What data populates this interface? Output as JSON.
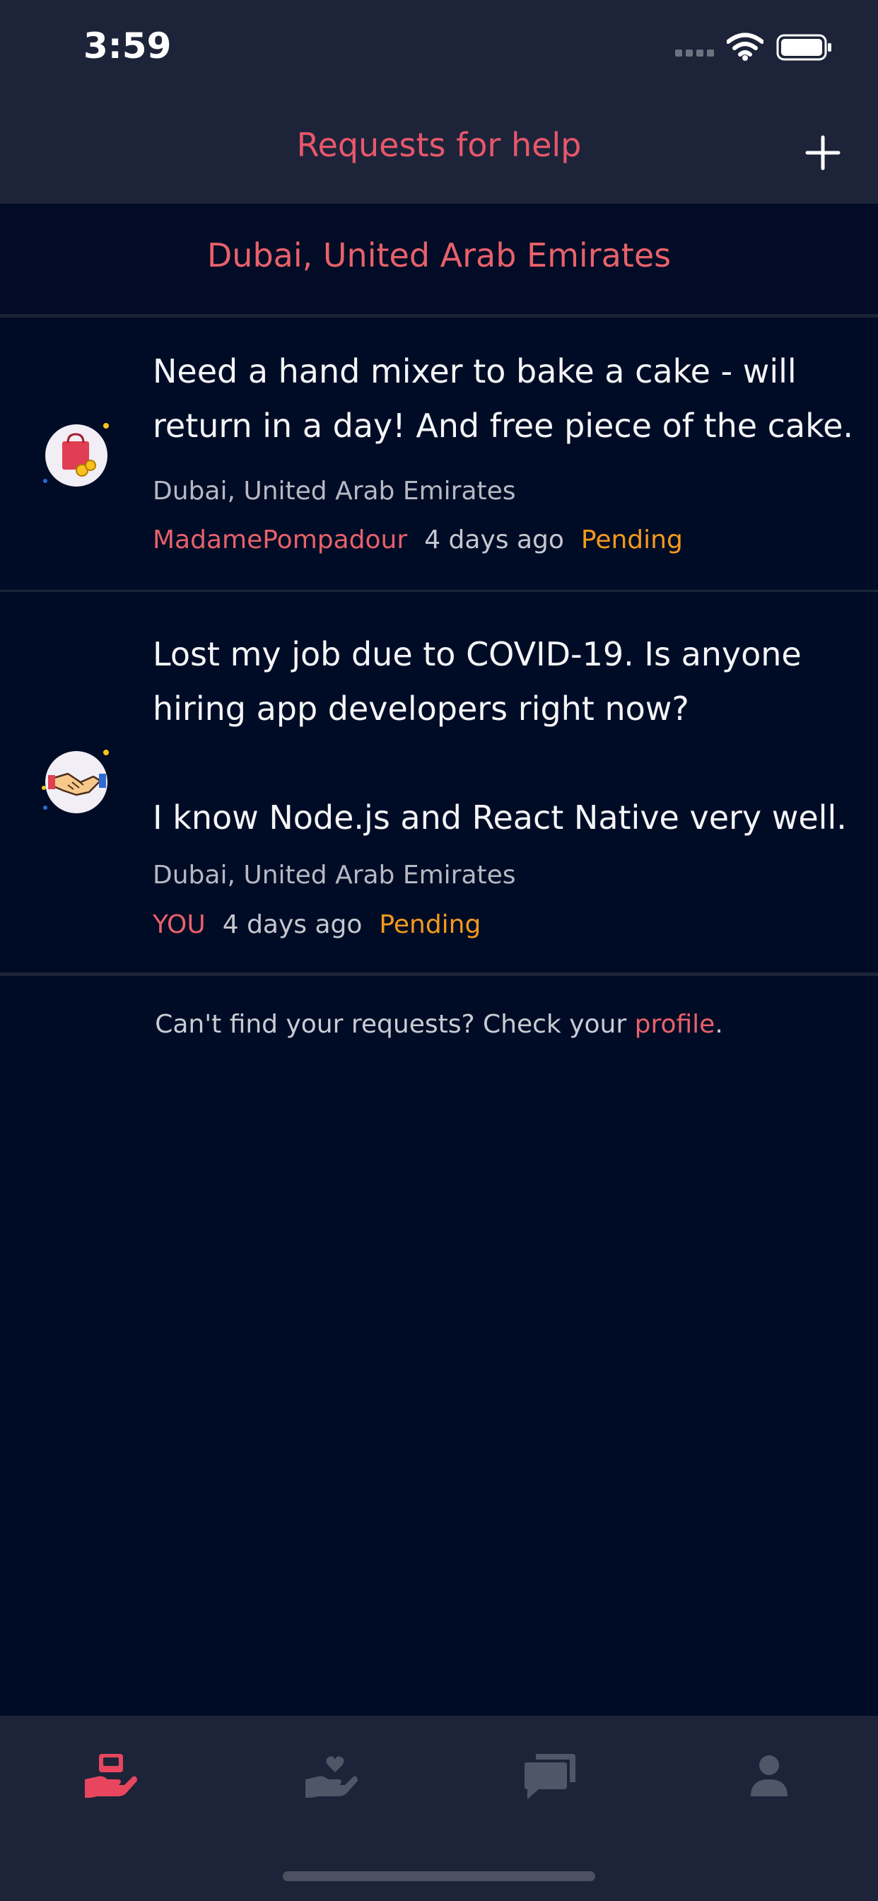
{
  "status_bar": {
    "time": "3:59"
  },
  "navbar": {
    "title": "Requests for help"
  },
  "location_header": "Dubai, United Arab Emirates",
  "requests": [
    {
      "text": "Need a hand mixer to bake a cake - will return in a day! And free piece of the cake.",
      "location": "Dubai, United Arab Emirates",
      "author": "MadamePompadour",
      "time": "4 days ago",
      "status": "Pending",
      "icon": "shopping-bag-icon"
    },
    {
      "text": "Lost my job due to COVID-19. Is anyone hiring app developers right now?\n\nI know Node.js and React Native very well.",
      "location": "Dubai, United Arab Emirates",
      "author": "YOU",
      "time": "4 days ago",
      "status": "Pending",
      "icon": "handshake-icon"
    }
  ],
  "footer": {
    "prefix": "Can't find your requests? Check your ",
    "link": "profile",
    "suffix": "."
  },
  "tabs": [
    {
      "icon": "requests-hand-icon",
      "active": true
    },
    {
      "icon": "heart-hand-icon",
      "active": false
    },
    {
      "icon": "messages-icon",
      "active": false
    },
    {
      "icon": "profile-icon",
      "active": false
    }
  ],
  "colors": {
    "accent": "#e8616a",
    "pending": "#f39a1c",
    "background": "#000c26",
    "bar": "#1d2439"
  }
}
